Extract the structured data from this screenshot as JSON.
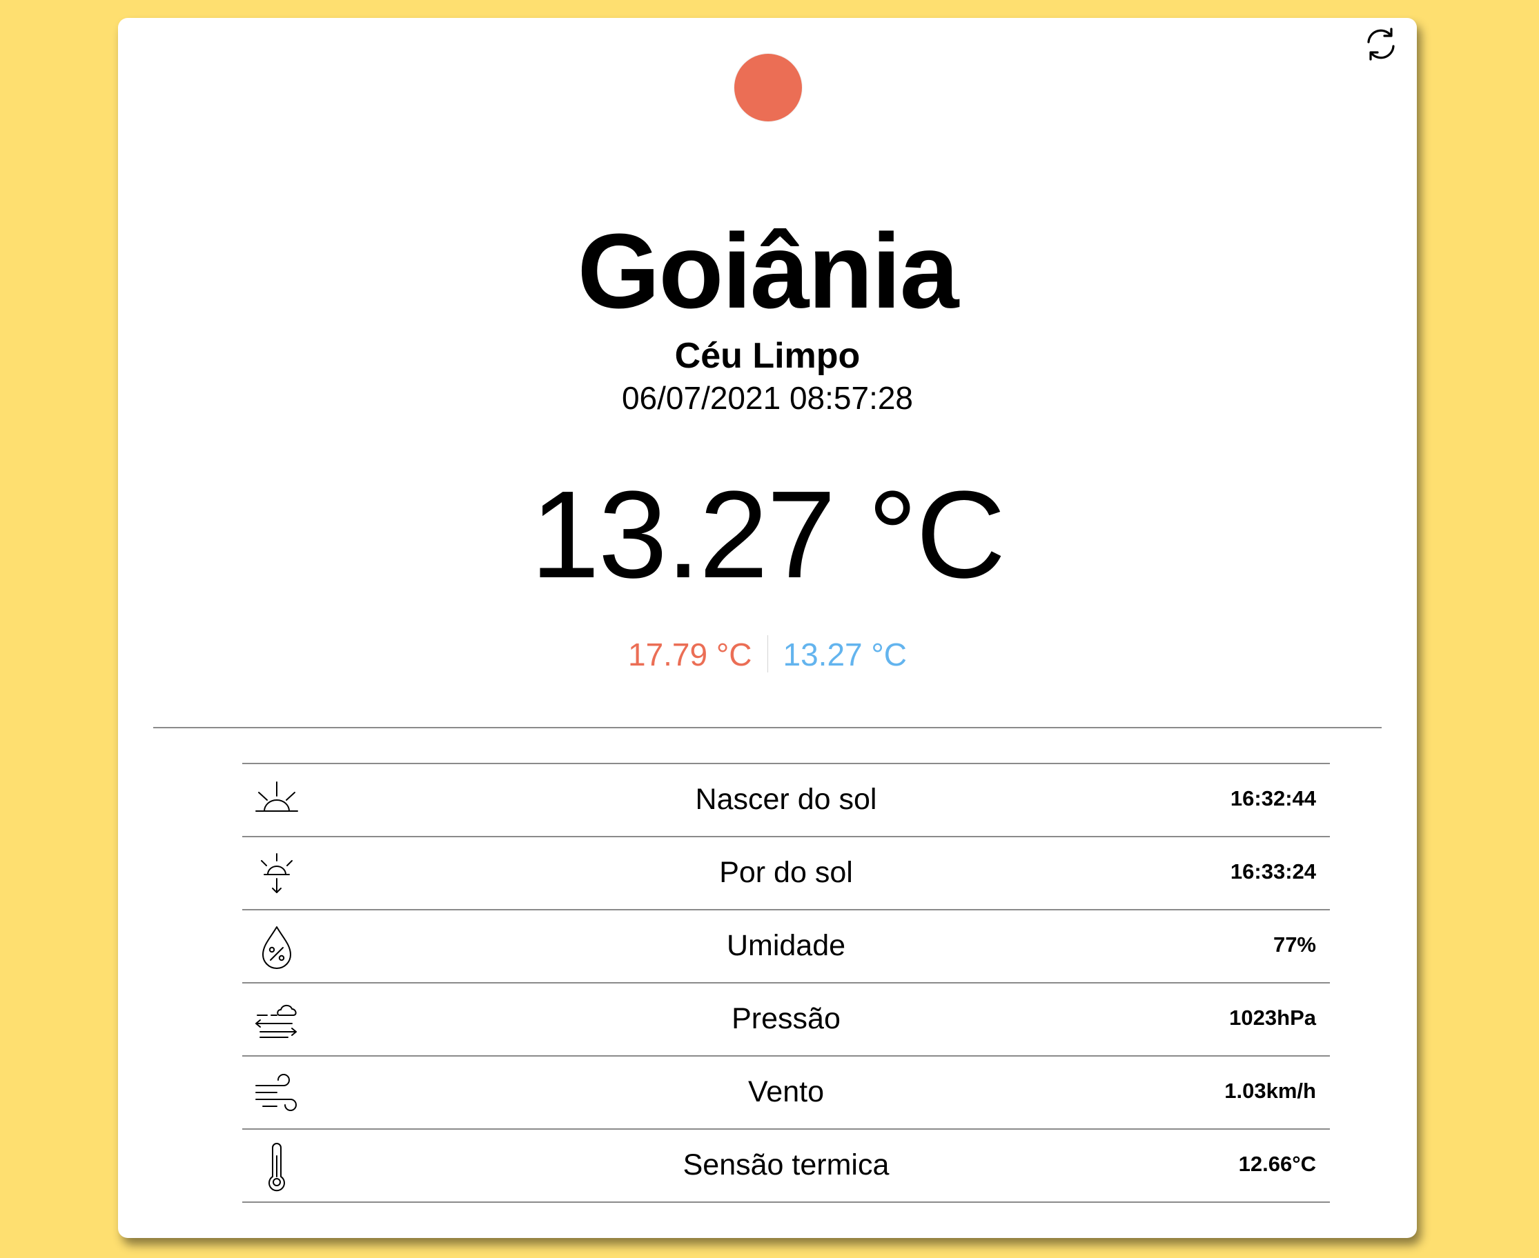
{
  "city": "Goiânia",
  "description": "Céu Limpo",
  "datetime": "06/07/2021 08:57:28",
  "temperature": "13.27 °C",
  "temp_max": "17.79 °C",
  "temp_min": "13.27 °C",
  "colors": {
    "background": "#FEDF70",
    "sun": "#EB6E55",
    "max": "#EB6E55",
    "min": "#63B4EE"
  },
  "refresh_icon": "refresh-icon",
  "details": [
    {
      "icon": "sunrise-icon",
      "label": "Nascer do sol",
      "value": "16:32:44"
    },
    {
      "icon": "sunset-icon",
      "label": "Por do sol",
      "value": "16:33:24"
    },
    {
      "icon": "humidity-icon",
      "label": "Umidade",
      "value": "77%"
    },
    {
      "icon": "pressure-icon",
      "label": "Pressão",
      "value": "1023hPa"
    },
    {
      "icon": "wind-icon",
      "label": "Vento",
      "value": "1.03km/h"
    },
    {
      "icon": "thermometer-icon",
      "label": "Sensão termica",
      "value": "12.66°C"
    }
  ]
}
